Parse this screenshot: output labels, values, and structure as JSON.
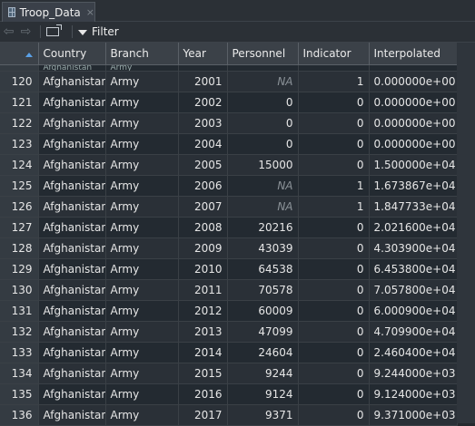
{
  "tab": {
    "title": "Troop_Data",
    "close": "×"
  },
  "toolbar": {
    "back": "⇦",
    "forward": "⇨",
    "filter_label": "Filter"
  },
  "columns": [
    "Country",
    "Branch",
    "Year",
    "Personnel",
    "Indicator",
    "Interpolated"
  ],
  "partial_row": {
    "country": "Afghanistan",
    "branch": "Army"
  },
  "rows": [
    {
      "n": "120",
      "country": "Afghanistan",
      "branch": "Army",
      "year": "2001",
      "personnel": "NA",
      "indicator": "1",
      "interpolated": "0.000000e+00"
    },
    {
      "n": "121",
      "country": "Afghanistan",
      "branch": "Army",
      "year": "2002",
      "personnel": "0",
      "indicator": "0",
      "interpolated": "0.000000e+00"
    },
    {
      "n": "122",
      "country": "Afghanistan",
      "branch": "Army",
      "year": "2003",
      "personnel": "0",
      "indicator": "0",
      "interpolated": "0.000000e+00"
    },
    {
      "n": "123",
      "country": "Afghanistan",
      "branch": "Army",
      "year": "2004",
      "personnel": "0",
      "indicator": "0",
      "interpolated": "0.000000e+00"
    },
    {
      "n": "124",
      "country": "Afghanistan",
      "branch": "Army",
      "year": "2005",
      "personnel": "15000",
      "indicator": "0",
      "interpolated": "1.500000e+04"
    },
    {
      "n": "125",
      "country": "Afghanistan",
      "branch": "Army",
      "year": "2006",
      "personnel": "NA",
      "indicator": "1",
      "interpolated": "1.673867e+04"
    },
    {
      "n": "126",
      "country": "Afghanistan",
      "branch": "Army",
      "year": "2007",
      "personnel": "NA",
      "indicator": "1",
      "interpolated": "1.847733e+04"
    },
    {
      "n": "127",
      "country": "Afghanistan",
      "branch": "Army",
      "year": "2008",
      "personnel": "20216",
      "indicator": "0",
      "interpolated": "2.021600e+04"
    },
    {
      "n": "128",
      "country": "Afghanistan",
      "branch": "Army",
      "year": "2009",
      "personnel": "43039",
      "indicator": "0",
      "interpolated": "4.303900e+04"
    },
    {
      "n": "129",
      "country": "Afghanistan",
      "branch": "Army",
      "year": "2010",
      "personnel": "64538",
      "indicator": "0",
      "interpolated": "6.453800e+04"
    },
    {
      "n": "130",
      "country": "Afghanistan",
      "branch": "Army",
      "year": "2011",
      "personnel": "70578",
      "indicator": "0",
      "interpolated": "7.057800e+04"
    },
    {
      "n": "131",
      "country": "Afghanistan",
      "branch": "Army",
      "year": "2012",
      "personnel": "60009",
      "indicator": "0",
      "interpolated": "6.000900e+04"
    },
    {
      "n": "132",
      "country": "Afghanistan",
      "branch": "Army",
      "year": "2013",
      "personnel": "47099",
      "indicator": "0",
      "interpolated": "4.709900e+04"
    },
    {
      "n": "133",
      "country": "Afghanistan",
      "branch": "Army",
      "year": "2014",
      "personnel": "24604",
      "indicator": "0",
      "interpolated": "2.460400e+04"
    },
    {
      "n": "134",
      "country": "Afghanistan",
      "branch": "Army",
      "year": "2015",
      "personnel": "9244",
      "indicator": "0",
      "interpolated": "9.244000e+03"
    },
    {
      "n": "135",
      "country": "Afghanistan",
      "branch": "Army",
      "year": "2016",
      "personnel": "9124",
      "indicator": "0",
      "interpolated": "9.124000e+03"
    },
    {
      "n": "136",
      "country": "Afghanistan",
      "branch": "Army",
      "year": "2017",
      "personnel": "9371",
      "indicator": "0",
      "interpolated": "9.371000e+03"
    }
  ]
}
